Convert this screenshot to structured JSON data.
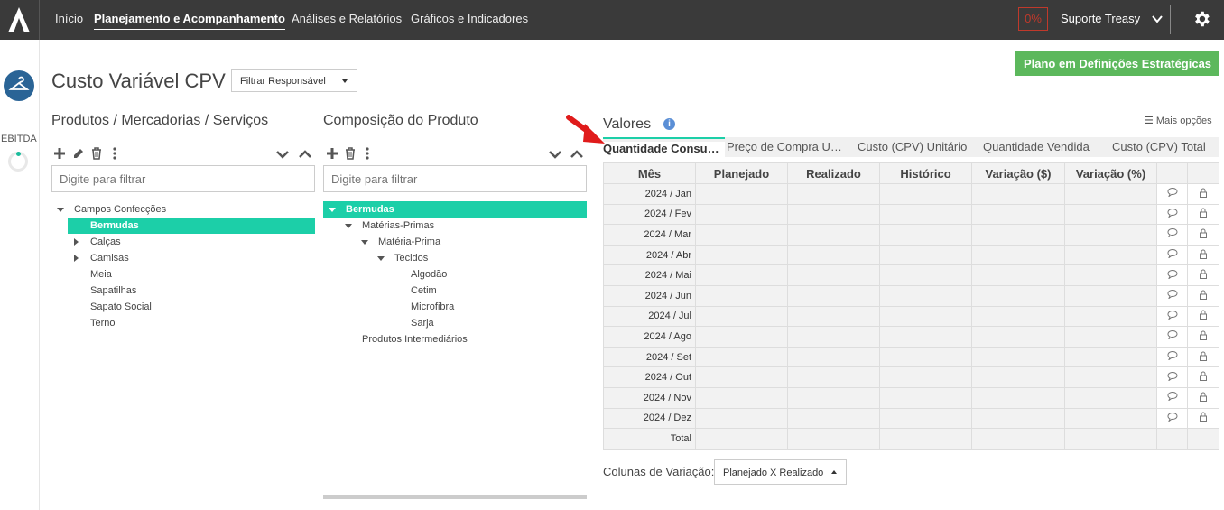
{
  "topbar": {
    "nav": [
      "Início",
      "Planejamento e Acompanhamento",
      "Análises e Relatórios",
      "Gráficos e Indicadores"
    ],
    "active_nav": "Planejamento e Acompanhamento",
    "percent": "0%",
    "support": "Suporte Treasy"
  },
  "left_rail": {
    "label": "EBITDA"
  },
  "page": {
    "title": "Custo Variável CPV",
    "filter": "Filtrar Responsável",
    "plan_button": "Plano em Definições Estratégicas"
  },
  "products": {
    "title": "Produtos / Mercadorias / Serviços",
    "placeholder": "Digite para filtrar",
    "tree": [
      "Campos Confecções",
      "Bermudas",
      "Calças",
      "Camisas",
      "Meia",
      "Sapatilhas",
      "Sapato Social",
      "Terno"
    ]
  },
  "composition": {
    "title": "Composição do Produto",
    "placeholder": "Digite para filtrar",
    "tree": [
      "Bermudas",
      "Matérias-Primas",
      "Matéria-Prima",
      "Tecidos",
      "Algodão",
      "Cetim",
      "Microfibra",
      "Sarja",
      "Produtos Intermediários"
    ]
  },
  "values": {
    "title": "Valores",
    "more": "Mais opções",
    "tabs": [
      "Quantidade Consumida",
      "Preço de Compra Unitário",
      "Custo (CPV) Unitário",
      "Quantidade Vendida",
      "Custo (CPV) Total"
    ],
    "active_tab": "Quantidade Consumida",
    "columns": [
      "Mês",
      "Planejado",
      "Realizado",
      "Histórico",
      "Variação ($)",
      "Variação (%)"
    ],
    "months": [
      "2024 / Jan",
      "2024 / Fev",
      "2024 / Mar",
      "2024 / Abr",
      "2024 / Mai",
      "2024 / Jun",
      "2024 / Jul",
      "2024 / Ago",
      "2024 / Set",
      "2024 / Out",
      "2024 / Nov",
      "2024 / Dez"
    ],
    "total": "Total",
    "variation_label": "Colunas de Variação:",
    "variation_select": "Planejado X Realizado"
  },
  "colors": {
    "accent": "#1ccfa8",
    "topbar": "#3a3a3a",
    "button": "#5cb85c",
    "alert": "#c0392b"
  },
  "icons": [
    "logo-icon",
    "chevron-down-icon",
    "gear-icon",
    "hanger-icon",
    "plus-icon",
    "pencil-icon",
    "trash-icon",
    "kebab-icon",
    "expand-icon",
    "collapse-icon",
    "info-icon",
    "menu-icon",
    "comment-icon",
    "lock-icon",
    "arrow-pointer-icon"
  ]
}
